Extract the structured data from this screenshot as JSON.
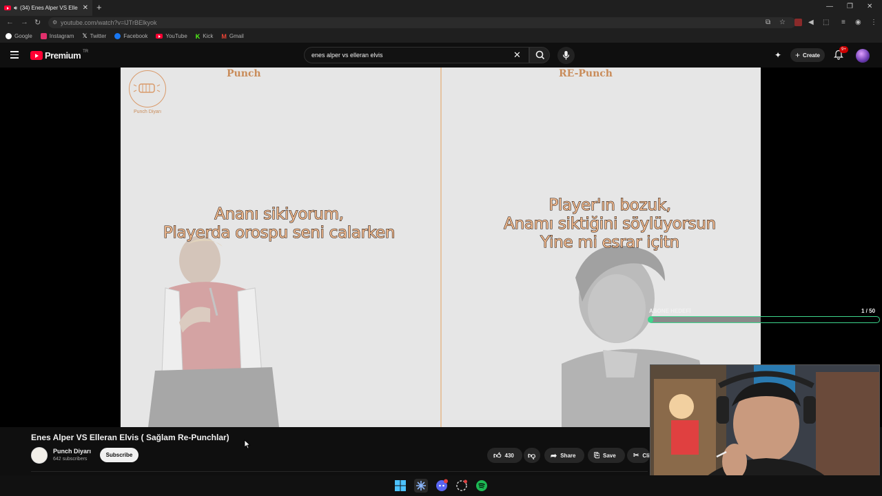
{
  "browser": {
    "tab_title": "(34) Enes Alper VS Elle",
    "url": "youtube.com/watch?v=lJTrBElkyok",
    "bookmarks": [
      {
        "label": "Google",
        "icon": "google-icon",
        "color": "#ffffff"
      },
      {
        "label": "Instagram",
        "icon": "instagram-icon",
        "color": "#e1306c"
      },
      {
        "label": "Twitter",
        "icon": "x-icon",
        "color": "#ffffff"
      },
      {
        "label": "Facebook",
        "icon": "facebook-icon",
        "color": "#1877f2"
      },
      {
        "label": "YouTube",
        "icon": "youtube-icon",
        "color": "#ff0033"
      },
      {
        "label": "Kick",
        "icon": "kick-icon",
        "color": "#53fc18"
      },
      {
        "label": "Gmail",
        "icon": "gmail-icon",
        "color": "#ea4335"
      }
    ]
  },
  "youtube": {
    "logo_text": "Premium",
    "logo_region": "TR",
    "search_query": "enes alper vs elleran elvis",
    "create_label": "Create",
    "notification_badge": "9+"
  },
  "video": {
    "left_heading": "Punch",
    "right_heading": "RE-Punch",
    "channel_logo_label": "Punch Diyarı",
    "left_lyric": [
      "Ananı sikiyorum,",
      "Playerda orospu seni calarken"
    ],
    "right_lyric": [
      "Player'ın bozuk,",
      "Anamı siktiğini söylüyorsun",
      "Yine mi esrar içitn"
    ],
    "goal_label": "ABONE HEDEFİ",
    "goal_count": "1 / 50",
    "goal_progress": 0.02
  },
  "meta": {
    "title": "Enes Alper VS Elleran Elvis ( Sağlam Re-Punchlar)",
    "channel_name": "Punch Diyarı",
    "subscribers": "642 subscribers",
    "subscribe_label": "Subscribe",
    "likes": "430",
    "share_label": "Share",
    "save_label": "Save",
    "clip_label": "Cli"
  },
  "colors": {
    "accent_orange": "#c98c5a",
    "goal_green": "#3dd68c",
    "youtube_red": "#ff0033"
  }
}
